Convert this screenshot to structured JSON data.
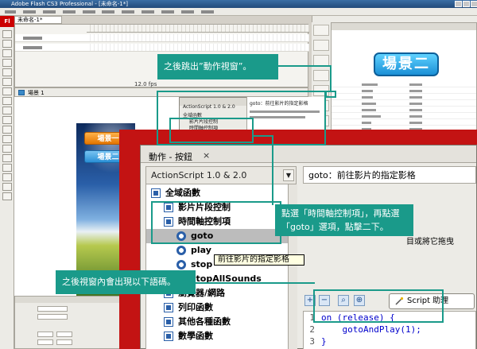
{
  "app": {
    "window_title": "Adobe Flash CS3 Professional - [未命名-1*]",
    "logo": "Fl",
    "document_tab": "未命名-1*",
    "menu": [
      "",
      "",
      "",
      "",
      "",
      "",
      "",
      "",
      "",
      "",
      ""
    ]
  },
  "timeline": {
    "layers": [
      {
        "name": ""
      },
      {
        "name": ""
      }
    ],
    "fps": "12.0 fps"
  },
  "scene_bar": {
    "label": "場景 1"
  },
  "stage": {
    "buttons": [
      {
        "label": "場景一",
        "color": "#ff9a1a"
      },
      {
        "label": "場景二",
        "color": "#3aa6e8"
      }
    ]
  },
  "library": {
    "header": "",
    "preview_label": "場景二",
    "rows": 9
  },
  "small_actions_panel": {
    "version": "ActionScript 1.0 & 2.0",
    "desc": "goto：前往影片的指定影格",
    "items": [
      "全域函數",
      "影片片段控制",
      "時間軸控制項"
    ]
  },
  "actions_panel": {
    "tab_label": "動作 - 按鈕",
    "close": "×",
    "version": "ActionScript 1.0 & 2.0",
    "tree": [
      {
        "label": "全域函數",
        "icon": "book-icon",
        "indent": 0
      },
      {
        "label": "影片片段控制",
        "icon": "book-icon",
        "indent": 1
      },
      {
        "label": "時間軸控制項",
        "icon": "book-icon",
        "indent": 1
      },
      {
        "label": "goto",
        "icon": "circle-arrow-icon",
        "indent": 2,
        "selected": true
      },
      {
        "label": "play",
        "icon": "circle-arrow-icon",
        "indent": 2
      },
      {
        "label": "stop",
        "icon": "circle-arrow-icon",
        "indent": 2
      },
      {
        "label": "stopAllSounds",
        "icon": "circle-arrow-icon",
        "indent": 2
      },
      {
        "label": "瀏覽器/網路",
        "icon": "book-icon",
        "indent": 1
      },
      {
        "label": "列印函數",
        "icon": "book-icon",
        "indent": 1
      },
      {
        "label": "其他各種函數",
        "icon": "book-icon",
        "indent": 1
      },
      {
        "label": "數學函數",
        "icon": "book-icon",
        "indent": 1
      }
    ],
    "description": "goto：前往影片的指定影格",
    "description_tail": "目或將它拖曳",
    "script_assist_label": "Script 助理",
    "toolbar_icons": [
      "add-icon",
      "remove-icon",
      "find-icon",
      "target-icon"
    ],
    "code_lines": [
      {
        "num": "1",
        "text": "on (release) {"
      },
      {
        "num": "2",
        "text": "    gotoAndPlay(1);"
      },
      {
        "num": "3",
        "text": "}"
      }
    ]
  },
  "tooltip": "前往影片的指定影格",
  "callouts": {
    "c1": "之後跳出”動作視窗”。",
    "c2_line1": "點選「時間軸控制項」，再點選",
    "c2_line2": "「goto」選項，點擊二下。",
    "c3": "之後視窗內會出現以下語碼。"
  },
  "colors": {
    "callout": "#1a9a8a",
    "frame": "#c31313",
    "keyword": "#0000cc"
  }
}
